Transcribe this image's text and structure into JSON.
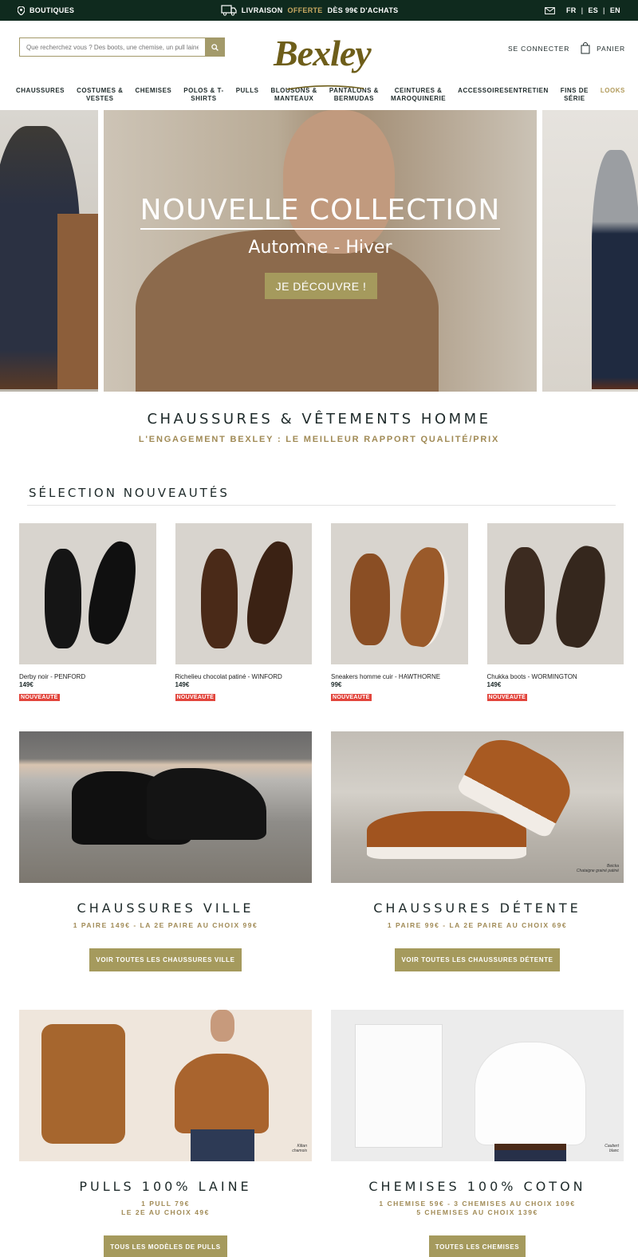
{
  "topbar": {
    "stores_label": "BOUTIQUES",
    "shipping_label": "LIVRAISON",
    "shipping_highlight": "OFFERTE",
    "shipping_rest": "DÈS 99€ D'ACHATS",
    "lang_fr": "FR",
    "lang_es": "ES",
    "lang_en": "EN",
    "lang_sep": "|"
  },
  "header": {
    "search_placeholder": "Que recherchez vous ? Des boots, une chemise, un pull laine ?",
    "logo": "Bexley",
    "login_label": "SE CONNECTER",
    "cart_label": "PANIER"
  },
  "nav": {
    "items": [
      {
        "line1": "CHAUSSURES",
        "line2": ""
      },
      {
        "line1": "COSTUMES &",
        "line2": "VESTES"
      },
      {
        "line1": "CHEMISES",
        "line2": ""
      },
      {
        "line1": "POLOS & T-",
        "line2": "SHIRTS"
      },
      {
        "line1": "PULLS",
        "line2": ""
      },
      {
        "line1": "BLOUSONS &",
        "line2": "MANTEAUX"
      },
      {
        "line1": "PANTALONS &",
        "line2": "BERMUDAS"
      },
      {
        "line1": "CEINTURES &",
        "line2": "MAROQUINERIE"
      },
      {
        "line1": "ACCESSOIRESENTRETIEN",
        "line2": ""
      },
      {
        "line1": "FINS DE",
        "line2": "SÉRIE"
      },
      {
        "line1": "LOOKS",
        "line2": ""
      }
    ]
  },
  "hero": {
    "title": "NOUVELLE COLLECTION",
    "subtitle": "Automne - Hiver",
    "cta": "JE DÉCOUVRE !"
  },
  "intro": {
    "title": "CHAUSSURES & VÊTEMENTS HOMME",
    "subtitle": "L'ENGAGEMENT BEXLEY : LE MEILLEUR RAPPORT QUALITÉ/PRIX"
  },
  "selection": {
    "title": "SÉLECTION NOUVEAUTÉS",
    "products": [
      {
        "name": "Derby noir - PENFORD",
        "price": "149€",
        "badge": "NOUVEAUTÉ"
      },
      {
        "name": "Richelieu chocolat patiné - WINFORD",
        "price": "149€",
        "badge": "NOUVEAUTÉ"
      },
      {
        "name": "Sneakers homme cuir - HAWTHORNE",
        "price": "99€",
        "badge": "NOUVEAUTÉ"
      },
      {
        "name": "Chukka boots - WORMINGTON",
        "price": "149€",
        "badge": "NOUVEAUTÉ"
      }
    ]
  },
  "categories": {
    "ville": {
      "title": "CHAUSSURES VILLE",
      "promo": "1 PAIRE 149€ - LA 2E PAIRE AU CHOIX 99€",
      "cta": "VOIR TOUTES LES CHAUSSURES VILLE"
    },
    "detente": {
      "title": "CHAUSSURES DÉTENTE",
      "promo": "1 PAIRE 99€ - LA 2E PAIRE AU CHOIX 69€",
      "cta": "VOIR TOUTES LES CHAUSSURES DÉTENTE",
      "img_caption1": "Beicka",
      "img_caption2": "Chataigne grainé patiné"
    },
    "pulls": {
      "title": "PULLS 100% LAINE",
      "promo1": "1 PULL 79€",
      "promo2": "LE 2E AU CHOIX 49€",
      "cta": "TOUS LES MODÈLES DE PULLS",
      "img_caption1": "Kiltan",
      "img_caption2": "chamois"
    },
    "chemises": {
      "title": "CHEMISES 100% COTON",
      "promo1": "1 CHEMISE 59€ - 3 CHEMISES AU CHOIX 109€",
      "promo2": "5 CHEMISES AU CHOIX 139€",
      "cta": "TOUTES LES CHEMISES",
      "img_caption1": "Caubert",
      "img_caption2": "blanc"
    }
  },
  "colors": {
    "topbar": "#0f2a1e",
    "accent": "#a59a5d",
    "badge": "#e2453c",
    "logo": "#6e5e1a"
  }
}
